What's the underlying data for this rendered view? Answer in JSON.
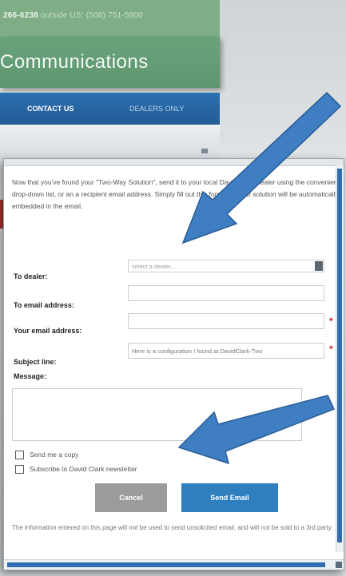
{
  "background_site": {
    "phone_text": "266-6238",
    "phone_text_secondary": "outside US: (508) 751-5800",
    "brand": "Communications",
    "nav": {
      "contact": "CONTACT US",
      "dealers": "DEALERS ONLY"
    }
  },
  "popup": {
    "intro": "Now that you've found your \"Two-Way Solution\", send it to your local David Clark dealer using the convenient drop-down list, or an a recipient email address. Simply fill out this form and your solution will be automatically embedded in the email.",
    "fields": {
      "dealer_label": "To dealer:",
      "dealer_placeholder": "select a dealer...",
      "to_email_label": "To email address:",
      "your_email_label": "Your email address:",
      "subject_label": "Subject line:",
      "subject_value": "Here is a configuration I found at DavidClark-Two",
      "message_label": "Message:",
      "required_marker": "*"
    },
    "checkboxes": {
      "copy": "Send me a copy",
      "newsletter": "Subscribe to David Clark newsletter"
    },
    "buttons": {
      "cancel": "Cancel",
      "send": "Send Email"
    },
    "disclaimer": "The information entered on this page will not be used to send unsolicited email, and will not be sold to a 3rd party."
  },
  "colors": {
    "annotation_arrow": "#3f7ec2",
    "send_button": "#2f7fbf",
    "cancel_button": "#9b9b9b",
    "required_asterisk": "#c62828"
  }
}
